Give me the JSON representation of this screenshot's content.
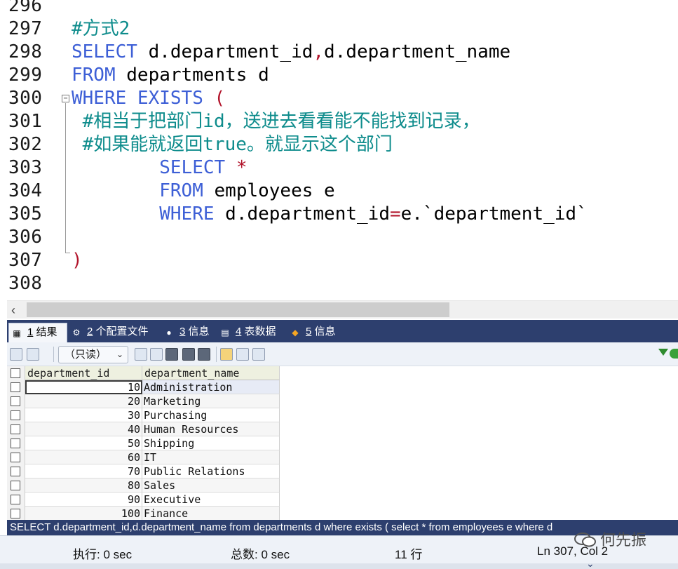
{
  "editor": {
    "lines": [
      {
        "num": "296",
        "segments": []
      },
      {
        "num": "297",
        "segments": [
          {
            "t": "#方式2",
            "c": "cm"
          }
        ]
      },
      {
        "num": "298",
        "segments": [
          {
            "t": "SELECT",
            "c": "kw"
          },
          {
            "t": " d.department_id",
            "c": ""
          },
          {
            "t": ",",
            "c": "op"
          },
          {
            "t": "d.department_name",
            "c": ""
          }
        ]
      },
      {
        "num": "299",
        "segments": [
          {
            "t": "FROM",
            "c": "kw"
          },
          {
            "t": " departments d",
            "c": ""
          }
        ]
      },
      {
        "num": "300",
        "segments": [
          {
            "t": "WHERE",
            "c": "kw"
          },
          {
            "t": " ",
            "c": ""
          },
          {
            "t": "EXISTS",
            "c": "kw"
          },
          {
            "t": " ",
            "c": ""
          },
          {
            "t": "(",
            "c": "op"
          }
        ]
      },
      {
        "num": "301",
        "segments": [
          {
            "t": " #相当于把部门id，送进去看看能不能找到记录，",
            "c": "cm"
          }
        ]
      },
      {
        "num": "302",
        "segments": [
          {
            "t": " #如果能就返回true。就显示这个部门",
            "c": "cm"
          }
        ]
      },
      {
        "num": "303",
        "segments": [
          {
            "t": "        ",
            "c": ""
          },
          {
            "t": "SELECT",
            "c": "kw"
          },
          {
            "t": " ",
            "c": ""
          },
          {
            "t": "*",
            "c": "op"
          }
        ]
      },
      {
        "num": "304",
        "segments": [
          {
            "t": "        ",
            "c": ""
          },
          {
            "t": "FROM",
            "c": "kw"
          },
          {
            "t": " employees e",
            "c": ""
          }
        ]
      },
      {
        "num": "305",
        "segments": [
          {
            "t": "        ",
            "c": ""
          },
          {
            "t": "WHERE",
            "c": "kw"
          },
          {
            "t": " d.department_id",
            "c": ""
          },
          {
            "t": "=",
            "c": "op"
          },
          {
            "t": "e.`department_id`",
            "c": ""
          }
        ]
      },
      {
        "num": "306",
        "segments": []
      },
      {
        "num": "307",
        "segments": [
          {
            "t": ")",
            "c": "op"
          }
        ]
      },
      {
        "num": "308",
        "segments": []
      }
    ]
  },
  "tabs": [
    {
      "num": "1",
      "label": "结果",
      "icon": "result-grid-icon",
      "active": true
    },
    {
      "num": "2",
      "label": "个配置文件",
      "icon": "profile-icon",
      "active": false
    },
    {
      "num": "3",
      "label": "信息",
      "icon": "info-icon",
      "active": false
    },
    {
      "num": "4",
      "label": "表数据",
      "icon": "table-data-icon",
      "active": false
    },
    {
      "num": "5",
      "label": "信息",
      "icon": "history-icon",
      "active": false
    }
  ],
  "toolbar": {
    "mode_select": "（只读）",
    "icons": [
      "export-icon",
      "import-icon",
      "add-row-icon",
      "duplicate-row-icon",
      "save-icon",
      "delete-icon",
      "cancel-icon",
      "grid-view-icon",
      "form-view-icon",
      "text-view-icon",
      "filter-icon"
    ]
  },
  "grid": {
    "columns": [
      "department_id",
      "department_name"
    ],
    "rows": [
      {
        "id": "10",
        "name": "Administration"
      },
      {
        "id": "20",
        "name": "Marketing"
      },
      {
        "id": "30",
        "name": "Purchasing"
      },
      {
        "id": "40",
        "name": "Human Resources"
      },
      {
        "id": "50",
        "name": "Shipping"
      },
      {
        "id": "60",
        "name": "IT"
      },
      {
        "id": "70",
        "name": "Public Relations"
      },
      {
        "id": "80",
        "name": "Sales"
      },
      {
        "id": "90",
        "name": "Executive"
      },
      {
        "id": "100",
        "name": "Finance"
      }
    ]
  },
  "query_text": "SELECT d.department_id,d.department_name from departments d where exists ( select * from employees e where d",
  "status": {
    "exec_time": "执行: 0 sec",
    "total_time": "总数: 0 sec",
    "rows": "11 行",
    "cursor": "Ln 307, Col 2"
  },
  "watermark": "何先振",
  "colors": {
    "keyword": "#3d5fd6",
    "comment": "#0e8c8c",
    "operator": "#b2142b",
    "tab_bar": "#2d3f6e"
  }
}
